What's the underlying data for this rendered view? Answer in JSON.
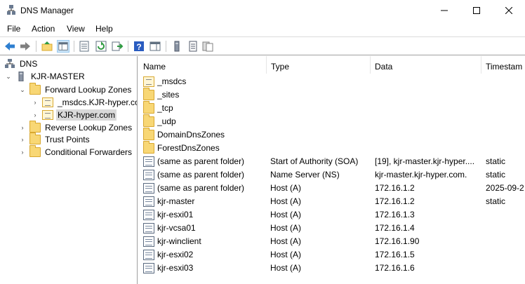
{
  "window": {
    "title": "DNS Manager"
  },
  "menu": [
    "File",
    "Action",
    "View",
    "Help"
  ],
  "tree": {
    "root": "DNS",
    "server": "KJR-MASTER",
    "forward_zones": "Forward Lookup Zones",
    "msdcs_zone": "_msdcs.KJR-hyper.co",
    "selected_zone": "KJR-hyper.com",
    "reverse_zones": "Reverse Lookup Zones",
    "trust_points": "Trust Points",
    "conditional_forwarders": "Conditional Forwarders"
  },
  "list": {
    "columns": [
      "Name",
      "Type",
      "Data",
      "Timestam"
    ],
    "rows": [
      {
        "name": "_msdcs",
        "type": "",
        "data": "",
        "timestamp": "",
        "icon": "zone-icon"
      },
      {
        "name": "_sites",
        "type": "",
        "data": "",
        "timestamp": "",
        "icon": "folder-icon"
      },
      {
        "name": "_tcp",
        "type": "",
        "data": "",
        "timestamp": "",
        "icon": "folder-icon"
      },
      {
        "name": "_udp",
        "type": "",
        "data": "",
        "timestamp": "",
        "icon": "folder-icon"
      },
      {
        "name": "DomainDnsZones",
        "type": "",
        "data": "",
        "timestamp": "",
        "icon": "folder-icon"
      },
      {
        "name": "ForestDnsZones",
        "type": "",
        "data": "",
        "timestamp": "",
        "icon": "folder-icon"
      },
      {
        "name": "(same as parent folder)",
        "type": "Start of Authority (SOA)",
        "data": "[19], kjr-master.kjr-hyper....",
        "timestamp": "static",
        "icon": "record-icon"
      },
      {
        "name": "(same as parent folder)",
        "type": "Name Server (NS)",
        "data": "kjr-master.kjr-hyper.com.",
        "timestamp": "static",
        "icon": "record-icon"
      },
      {
        "name": "(same as parent folder)",
        "type": "Host (A)",
        "data": "172.16.1.2",
        "timestamp": "2025-09-2",
        "icon": "record-icon"
      },
      {
        "name": "kjr-master",
        "type": "Host (A)",
        "data": "172.16.1.2",
        "timestamp": "static",
        "icon": "record-icon"
      },
      {
        "name": "kjr-esxi01",
        "type": "Host (A)",
        "data": "172.16.1.3",
        "timestamp": "",
        "icon": "record-icon"
      },
      {
        "name": "kjr-vcsa01",
        "type": "Host (A)",
        "data": "172.16.1.4",
        "timestamp": "",
        "icon": "record-icon"
      },
      {
        "name": "kjr-winclient",
        "type": "Host (A)",
        "data": "172.16.1.90",
        "timestamp": "",
        "icon": "record-icon"
      },
      {
        "name": "kjr-esxi02",
        "type": "Host (A)",
        "data": "172.16.1.5",
        "timestamp": "",
        "icon": "record-icon"
      },
      {
        "name": "kjr-esxi03",
        "type": "Host (A)",
        "data": "172.16.1.6",
        "timestamp": "",
        "icon": "record-icon"
      }
    ]
  }
}
